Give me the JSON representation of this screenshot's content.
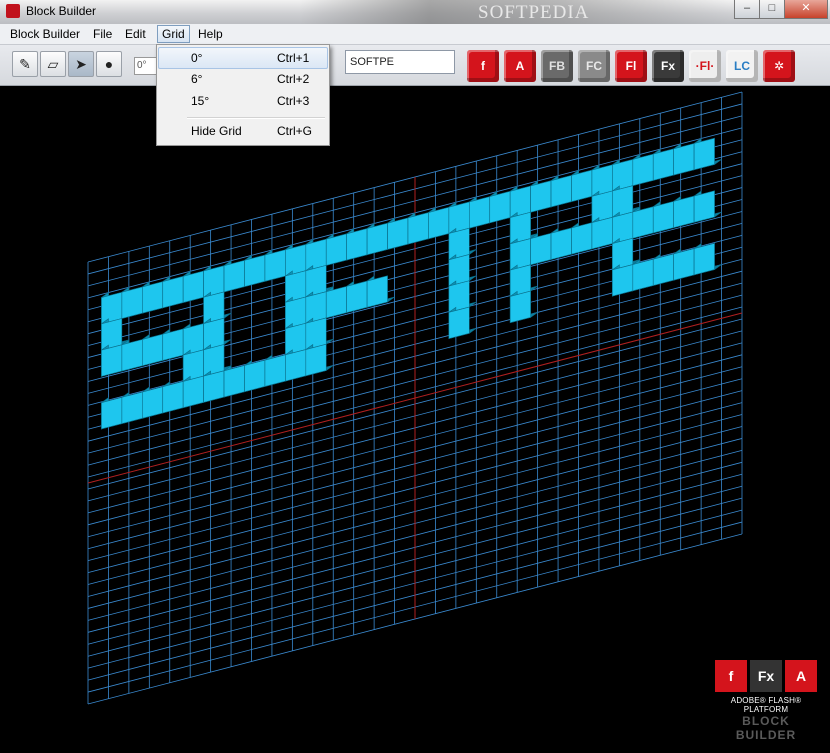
{
  "window": {
    "title": "Block Builder",
    "watermark": "SOFTPEDIA",
    "minimize_glyph": "–",
    "maximize_glyph": "□",
    "close_glyph": "✕"
  },
  "menu": {
    "items": [
      "Block Builder",
      "File",
      "Edit",
      "Grid",
      "Help"
    ],
    "active": "Grid"
  },
  "toolbar": {
    "tools": [
      {
        "name": "pencil-icon",
        "glyph": "✎"
      },
      {
        "name": "eraser-icon",
        "glyph": "▱"
      },
      {
        "name": "pointer-icon",
        "glyph": "➤"
      },
      {
        "name": "sphere-icon",
        "glyph": "●"
      }
    ],
    "angle_value": "0°",
    "text_value": "SOFTPE",
    "logos": [
      {
        "name": "flash-logo",
        "label": "f",
        "color": "#d4141c",
        "text": "#ffffff"
      },
      {
        "name": "acrobat-logo",
        "label": "A",
        "color": "#d4141c",
        "text": "#ffffff"
      },
      {
        "name": "fb-logo",
        "label": "FB",
        "color": "#6a6a6a",
        "text": "#e0e0e0"
      },
      {
        "name": "fc-logo",
        "label": "FC",
        "color": "#8a8a8a",
        "text": "#e8e8e8"
      },
      {
        "name": "fl-logo",
        "label": "Fl",
        "color": "#d4141c",
        "text": "#ffffff"
      },
      {
        "name": "fx-logo",
        "label": "Fx",
        "color": "#3a3a3a",
        "text": "#ffffff"
      },
      {
        "name": "fl2-logo",
        "label": "·Fl·",
        "color": "#eeeeee",
        "text": "#d4141c"
      },
      {
        "name": "lc-logo",
        "label": "LC",
        "color": "#f2f2f2",
        "text": "#2a7ec4"
      },
      {
        "name": "settings-logo",
        "label": "✲",
        "color": "#d4141c",
        "text": "#ffffff"
      }
    ]
  },
  "grid_menu": {
    "items": [
      {
        "label": "0°",
        "shortcut": "Ctrl+1",
        "highlighted": true
      },
      {
        "label": "6°",
        "shortcut": "Ctrl+2",
        "highlighted": false
      },
      {
        "label": "15°",
        "shortcut": "Ctrl+3",
        "highlighted": false
      },
      {
        "label": "Hide Grid",
        "shortcut": "Ctrl+G",
        "highlighted": false
      }
    ]
  },
  "canvas": {
    "block_text": "SOFTPE",
    "block_color": "#1ec6ee",
    "grid_color": "#3a8ad0",
    "axis_color": "#b02020"
  },
  "branding": {
    "logos": [
      {
        "label": "f",
        "color": "#d4141c"
      },
      {
        "label": "Fx",
        "color": "#333333"
      },
      {
        "label": "A",
        "color": "#d4141c"
      }
    ],
    "line1": "ADOBE® FLASH® PLATFORM",
    "line2": "BLOCK BUILDER"
  }
}
